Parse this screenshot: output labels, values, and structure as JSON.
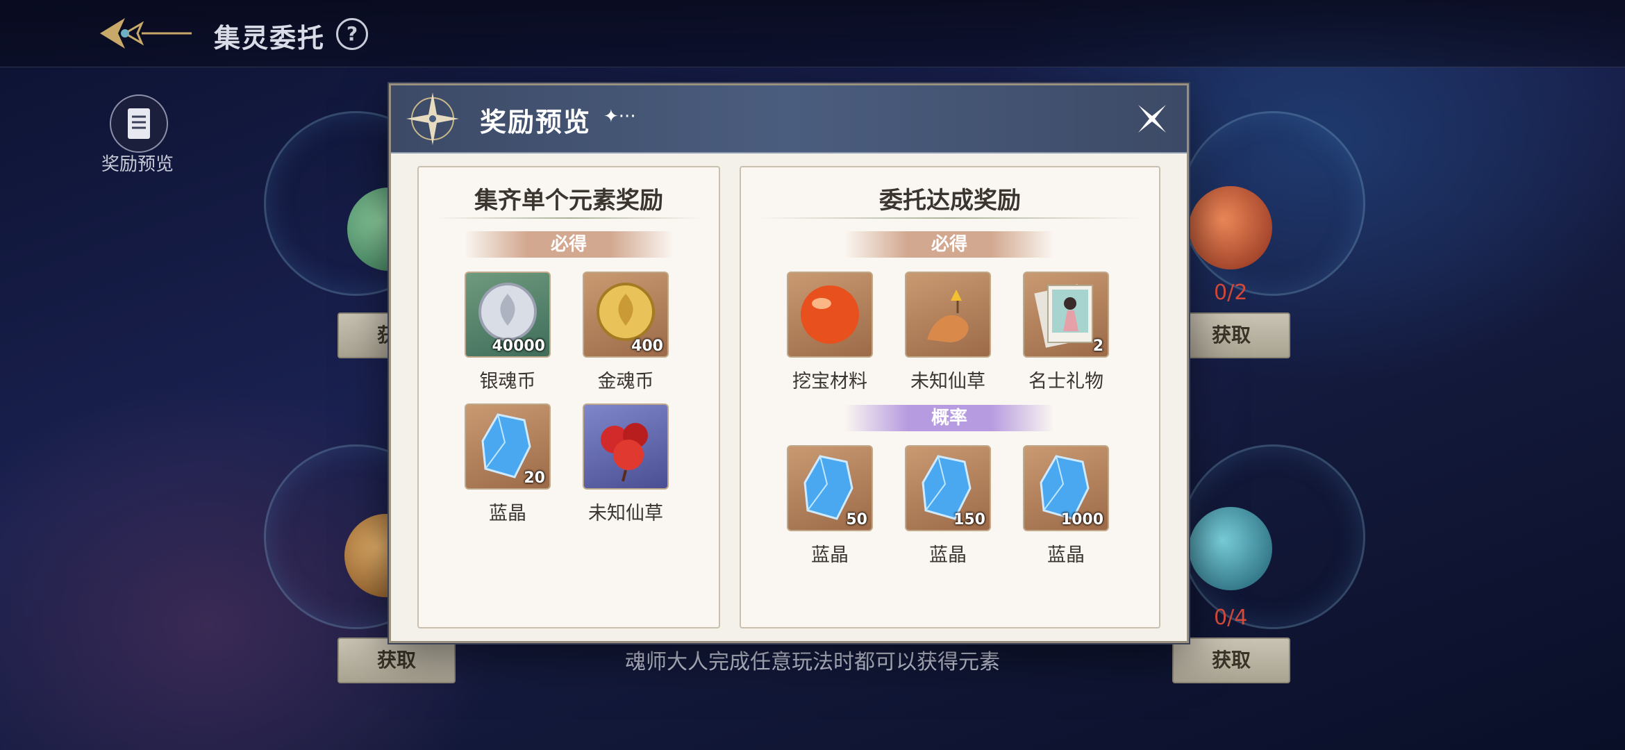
{
  "header": {
    "title": "集灵委托",
    "help_glyph": "?"
  },
  "side_menu": {
    "reward_preview_label": "奖励预览"
  },
  "elements": [
    {
      "count": "0/2",
      "get_label": "获取"
    },
    {
      "count": "0/4",
      "get_label": "获取"
    },
    {
      "get_label": "获取"
    },
    {
      "get_label": "获取"
    }
  ],
  "footer_hint": "魂师大人完成任意玩法时都可以获得元素",
  "modal": {
    "title": "奖励预览",
    "title_deco": "✦···",
    "left_panel": {
      "title": "集齐单个元素奖励",
      "must_tag": "必得",
      "items": [
        {
          "name": "银魂币",
          "qty": "40000",
          "icon": "silver-coin-icon"
        },
        {
          "name": "金魂币",
          "qty": "400",
          "icon": "gold-coin-icon"
        },
        {
          "name": "蓝晶",
          "qty": "20",
          "icon": "blue-crystal-icon"
        },
        {
          "name": "未知仙草",
          "qty": "",
          "icon": "red-herb-icon"
        }
      ]
    },
    "right_panel": {
      "title": "委托达成奖励",
      "must_tag": "必得",
      "prob_tag": "概率",
      "must_items": [
        {
          "name": "挖宝材料",
          "qty": "",
          "icon": "fire-orb-icon"
        },
        {
          "name": "未知仙草",
          "qty": "",
          "icon": "fox-herb-icon"
        },
        {
          "name": "名士礼物",
          "qty": "2",
          "icon": "portrait-card-icon"
        }
      ],
      "prob_items": [
        {
          "name": "蓝晶",
          "qty": "50",
          "icon": "blue-crystal-icon"
        },
        {
          "name": "蓝晶",
          "qty": "150",
          "icon": "blue-crystal-icon"
        },
        {
          "name": "蓝晶",
          "qty": "1000",
          "icon": "blue-crystal-icon"
        }
      ]
    }
  }
}
